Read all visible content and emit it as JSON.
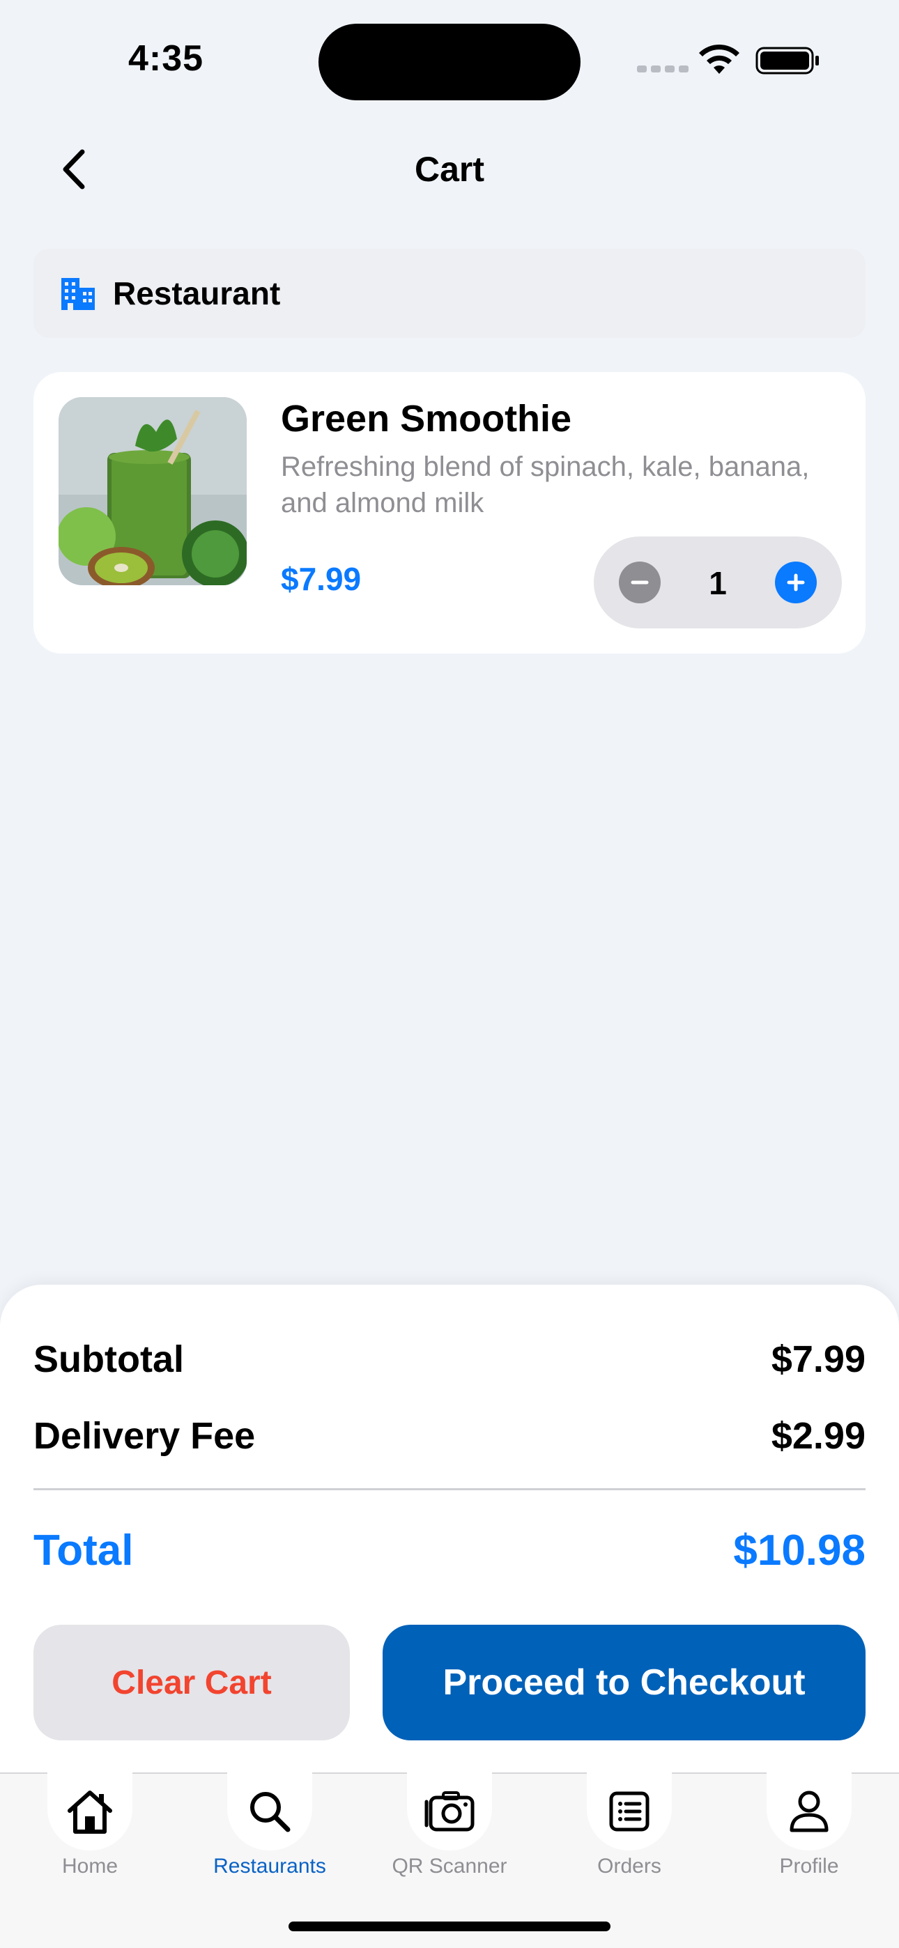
{
  "status_bar": {
    "time": "4:35"
  },
  "nav": {
    "title": "Cart"
  },
  "restaurant": {
    "name": "Restaurant",
    "icon": "building-icon"
  },
  "cart_items": [
    {
      "name": "Green Smoothie",
      "description": "Refreshing blend of spinach, kale, banana, and almond milk",
      "price": "$7.99",
      "quantity": "1"
    }
  ],
  "summary": {
    "subtotal_label": "Subtotal",
    "subtotal_value": "$7.99",
    "delivery_label": "Delivery Fee",
    "delivery_value": "$2.99",
    "total_label": "Total",
    "total_value": "$10.98"
  },
  "actions": {
    "clear_label": "Clear Cart",
    "checkout_label": "Proceed to Checkout"
  },
  "tabbar": {
    "active": "Restaurants",
    "items": [
      {
        "label": "Home",
        "icon": "home-icon"
      },
      {
        "label": "Restaurants",
        "icon": "search-icon"
      },
      {
        "label": "QR Scanner",
        "icon": "camera-icon"
      },
      {
        "label": "Orders",
        "icon": "list-icon"
      },
      {
        "label": "Profile",
        "icon": "person-icon"
      }
    ]
  },
  "colors": {
    "accent": "#0a7aff",
    "checkout_button": "#0061b8",
    "destructive": "#f2442f",
    "background": "#f0f4f9"
  }
}
